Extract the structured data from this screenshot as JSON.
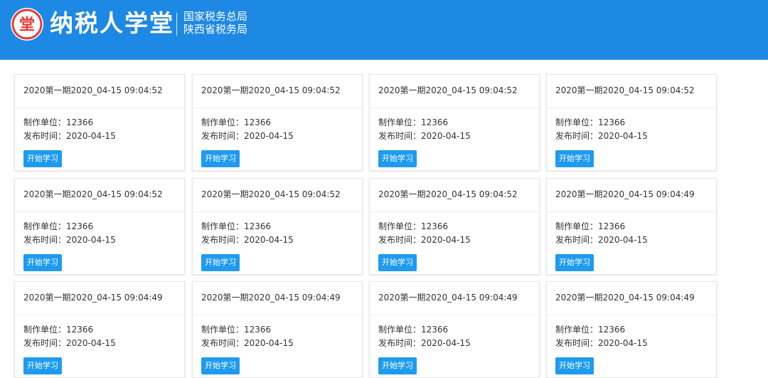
{
  "header": {
    "brand": "纳税人学堂",
    "org_line1": "国家税务总局",
    "org_line2": "陕西省税务局",
    "logo_char": "堂",
    "background": "#1e88e5",
    "logo_color": "#e53935"
  },
  "cards": [
    {
      "title": "2020第一期2020_04-15 09:04:52",
      "unit": "制作单位：12366",
      "date": "发布时间：2020-04-15",
      "button": "开始学习"
    },
    {
      "title": "2020第一期2020_04-15 09:04:52",
      "unit": "制作单位：12366",
      "date": "发布时间：2020-04-15",
      "button": "开始学习"
    },
    {
      "title": "2020第一期2020_04-15 09:04:52",
      "unit": "制作单位：12366",
      "date": "发布时间：2020-04-15",
      "button": "开始学习"
    },
    {
      "title": "2020第一期2020_04-15 09:04:52",
      "unit": "制作单位：12366",
      "date": "发布时间：2020-04-15",
      "button": "开始学习"
    },
    {
      "title": "2020第一期2020_04-15 09:04:52",
      "unit": "制作单位：12366",
      "date": "发布时间：2020-04-15",
      "button": "开始学习"
    },
    {
      "title": "2020第一期2020_04-15 09:04:52",
      "unit": "制作单位：12366",
      "date": "发布时间：2020-04-15",
      "button": "开始学习"
    },
    {
      "title": "2020第一期2020_04-15 09:04:52",
      "unit": "制作单位：12366",
      "date": "发布时间：2020-04-15",
      "button": "开始学习"
    },
    {
      "title": "2020第一期2020_04-15 09:04:49",
      "unit": "制作单位：12366",
      "date": "发布时间：2020-04-15",
      "button": "开始学习"
    },
    {
      "title": "2020第一期2020_04-15 09:04:49",
      "unit": "制作单位：12366",
      "date": "发布时间：2020-04-15",
      "button": "开始学习"
    },
    {
      "title": "2020第一期2020_04-15 09:04:49",
      "unit": "制作单位：12366",
      "date": "发布时间：2020-04-15",
      "button": "开始学习"
    },
    {
      "title": "2020第一期2020_04-15 09:04:49",
      "unit": "制作单位：12366",
      "date": "发布时间：2020-04-15",
      "button": "开始学习"
    },
    {
      "title": "2020第一期2020_04-15 09:04:49",
      "unit": "制作单位：12366",
      "date": "发布时间：2020-04-15",
      "button": "开始学习"
    }
  ]
}
